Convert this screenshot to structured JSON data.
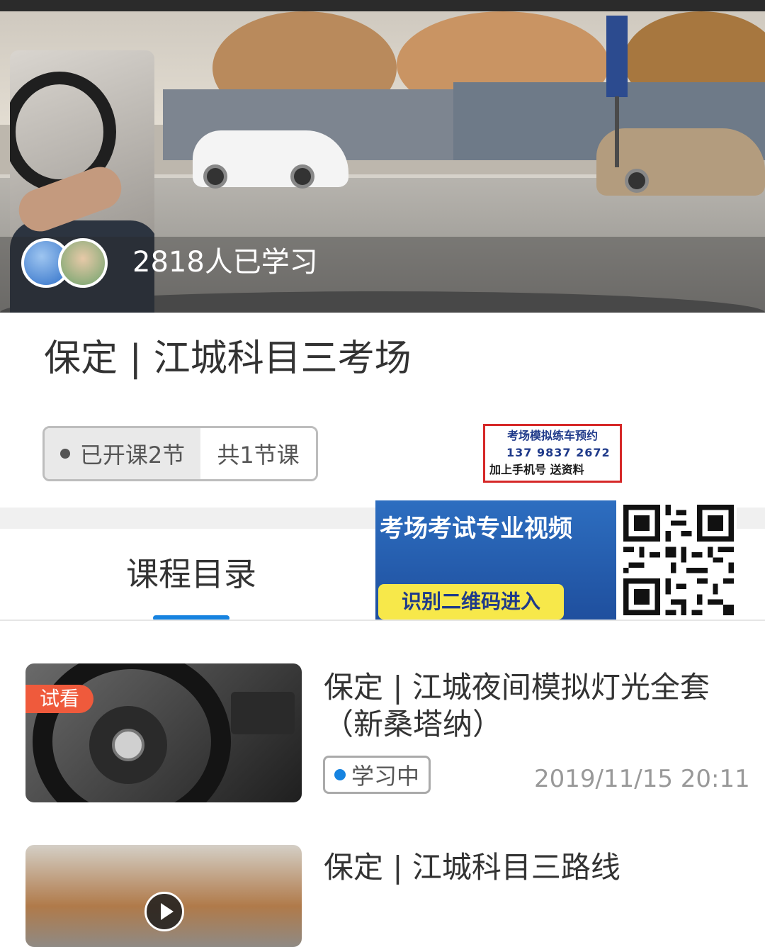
{
  "hero": {
    "learned_count": "2818人已学习"
  },
  "course": {
    "title": "保定 | 江城科目三考场",
    "opened_label": "已开课2节",
    "total_label": "共1节课"
  },
  "promo": {
    "line1": "考场模拟练车预约",
    "line2": "137  9837  2672",
    "line3": "加上手机号    送资料"
  },
  "qr_banner": {
    "headline": "考场考试专业视频",
    "button": "识别二维码进入"
  },
  "tabs": {
    "catalog": "课程目录"
  },
  "lessons": [
    {
      "badge": "试看",
      "title": "保定 | 江城夜间模拟灯光全套（新桑塔纳）",
      "status": "学习中",
      "date": "2019/11/15 20:11"
    },
    {
      "title": "保定 | 江城科目三路线"
    }
  ],
  "colors": {
    "accent": "#1683e0",
    "badge": "#ef5a3c",
    "promo_border": "#d62828"
  }
}
